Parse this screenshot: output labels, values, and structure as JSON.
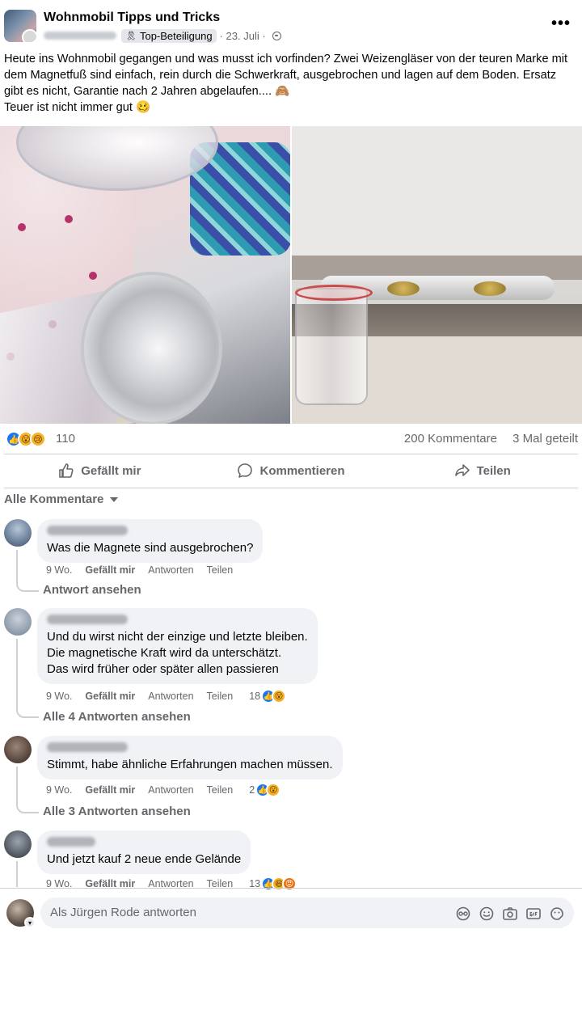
{
  "post": {
    "group_name": "Wohnmobil Tipps und Tricks",
    "badge": "Top-Beteiligung",
    "date": "· 23. Juli ·",
    "more_label": "•••",
    "text_lines": [
      "Heute ins Wohnmobil gegangen und was musst ich vorfinden? Zwei Weizengläser von der teuren Marke mit dem Magnetfuß sind einfach, rein durch die Schwerkraft, ausgebrochen und lagen auf dem Boden. Ersatz gibt es nicht, Garantie nach 2 Jahren abgelaufen.... 🙈",
      "Teuer ist nicht immer gut 🥴"
    ]
  },
  "stats": {
    "reaction_icons": [
      "👍",
      "😮",
      "😢"
    ],
    "reaction_count": "110",
    "comments": "200 Kommentare",
    "shares": "3 Mal geteilt"
  },
  "actions": {
    "like": "Gefällt mir",
    "comment": "Kommentieren",
    "share": "Teilen"
  },
  "filter": {
    "label": "Alle Kommentare"
  },
  "comments": [
    {
      "lines": [
        "Was die Magnete sind ausgebrochen?"
      ],
      "time": "9 Wo.",
      "like": "Gefällt mir",
      "reply": "Antworten",
      "share": "Teilen",
      "reaction_count": "",
      "replies": "Antwort ansehen"
    },
    {
      "lines": [
        "Und du wirst nicht der einzige und letzte bleiben.",
        "Die magnetische Kraft wird da unterschätzt.",
        "Das wird früher oder später allen passieren"
      ],
      "time": "9 Wo.",
      "like": "Gefällt mir",
      "reply": "Antworten",
      "share": "Teilen",
      "reaction_count": "18",
      "replies": "Alle 4 Antworten ansehen"
    },
    {
      "lines": [
        "Stimmt, habe ähnliche Erfahrungen machen müssen."
      ],
      "time": "9 Wo.",
      "like": "Gefällt mir",
      "reply": "Antworten",
      "share": "Teilen",
      "reaction_count": "2",
      "replies": "Alle 3 Antworten ansehen"
    },
    {
      "lines": [
        "Und jetzt kauf 2 neue ende Gelände"
      ],
      "time": "9 Wo.",
      "like": "Gefällt mir",
      "reply": "Antworten",
      "share": "Teilen",
      "reaction_count": "13",
      "replies": ""
    }
  ],
  "composer": {
    "placeholder": "Als Jürgen Rode antworten",
    "tools": [
      "avatar-sticker-icon",
      "emoji-icon",
      "camera-icon",
      "gif-icon",
      "sticker-icon"
    ]
  }
}
